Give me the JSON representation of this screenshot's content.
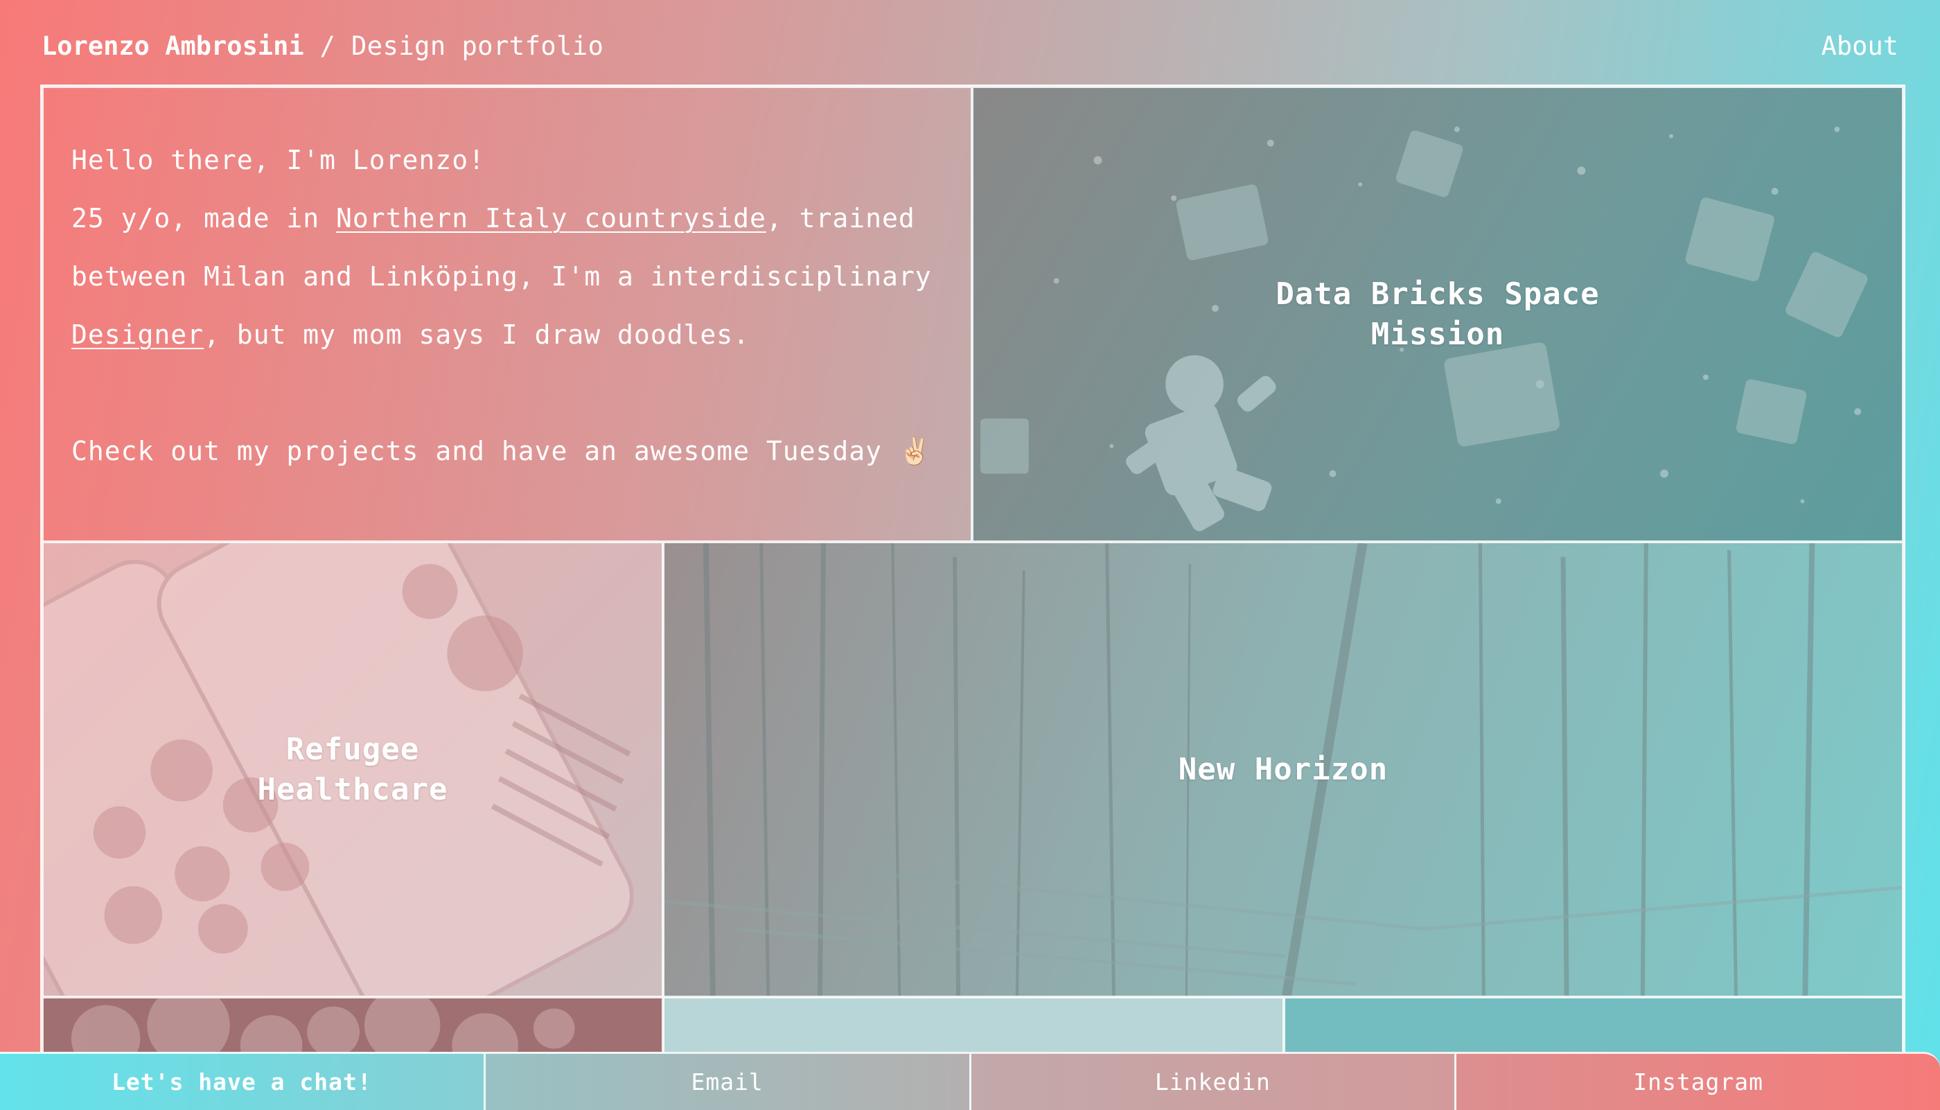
{
  "header": {
    "name": "Lorenzo Ambrosini",
    "separator": " / ",
    "subtitle": "Design portfolio",
    "about_link": "About"
  },
  "intro": {
    "line1": "Hello there, I'm Lorenzo!",
    "line2_prefix": "25 y/o, made in ",
    "line2_link": "Northern Italy countryside",
    "line2_suffix": ", trained",
    "line3": "between Milan and Linköping, I'm a interdisciplinary",
    "line4_link": "Designer",
    "line4_suffix": ", but my mom says I draw doodles.",
    "line5": "Check out my projects and have an awesome Tuesday ✌🏻"
  },
  "projects": [
    {
      "title_line1": "Data Bricks Space",
      "title_line2": "Mission"
    },
    {
      "title_line1": "Refugee",
      "title_line2": "Healthcare"
    },
    {
      "title_line1": "New Horizon",
      "title_line2": ""
    }
  ],
  "footer": {
    "chat": "Let's have a chat!",
    "email": "Email",
    "linkedin": "Linkedin",
    "instagram": "Instagram"
  }
}
